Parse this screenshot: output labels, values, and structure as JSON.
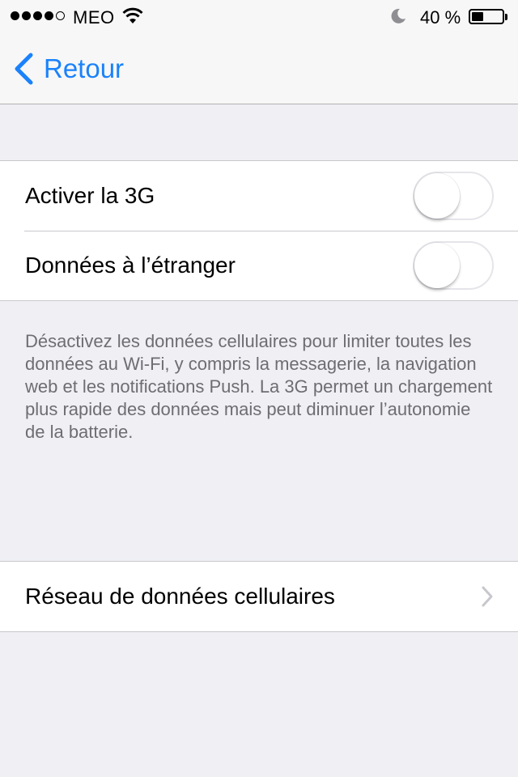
{
  "status_bar": {
    "signal_bars": 5,
    "signal_filled": 4,
    "carrier": "MEO",
    "battery_percent": "40 %",
    "battery_level": 0.4
  },
  "nav": {
    "back_label": "Retour"
  },
  "toggles_group": {
    "items": [
      {
        "label": "Activer la 3G",
        "on": false
      },
      {
        "label": "Données à l’étranger",
        "on": false
      }
    ]
  },
  "footer_note": "Désactivez les données cellulaires pour limiter toutes les données au Wi-Fi, y compris la messagerie, la navigation web et les notifications Push. La 3G permet un chargement plus rapide des données mais peut diminuer l’autonomie de la batterie.",
  "network_group": {
    "items": [
      {
        "label": "Réseau de données cellulaires"
      }
    ]
  },
  "colors": {
    "accent": "#1a82fb",
    "background": "#efeff4",
    "separator": "#c8c7cc",
    "footer_text": "#6d6d72"
  }
}
